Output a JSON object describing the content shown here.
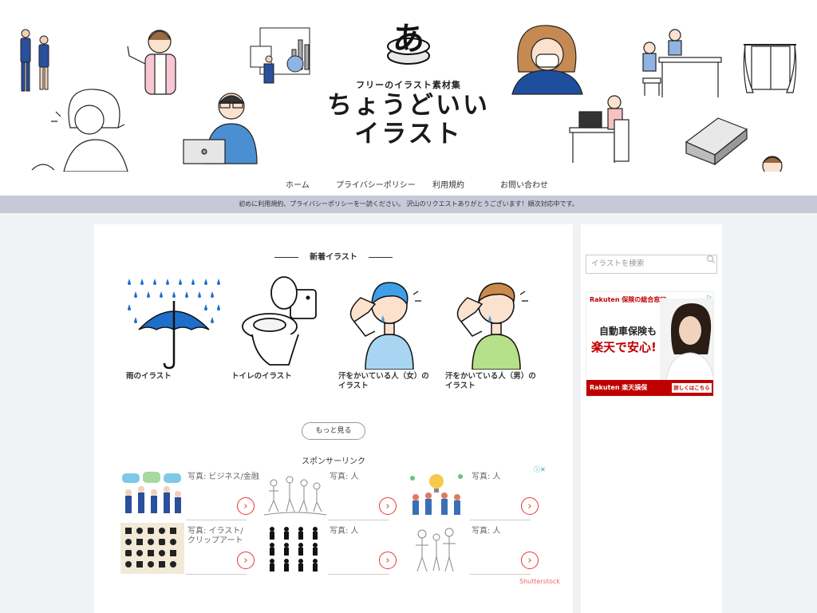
{
  "header": {
    "tagline": "フリーのイラスト素材集",
    "title_line1": "ちょうどいい",
    "title_line2": "イラスト"
  },
  "nav": [
    {
      "label": "ホーム"
    },
    {
      "label": "プライバシーポリシー"
    },
    {
      "label": "利用規約"
    },
    {
      "label": "お問い合わせ"
    }
  ],
  "notice": "初めに利用規約、プライバシーポリシーを一読ください。 沢山のリクエストありがとうございます！順次対応中です。",
  "main": {
    "section_title": "新着イラスト",
    "cards": [
      {
        "caption": "雨のイラスト"
      },
      {
        "caption": "トイレのイラスト"
      },
      {
        "caption": "汗をかいている人（女）の\nイラスト"
      },
      {
        "caption": "汗をかいている人（男）の\nイラスト"
      }
    ],
    "more_label": "もっと見る",
    "sponsor_label": "スポンサーリンク",
    "ads": [
      {
        "text": "写真: ビジネス/金融"
      },
      {
        "text": "写真: 人"
      },
      {
        "text": "写真: 人"
      },
      {
        "text": "写真: イラスト/\nクリップアート"
      },
      {
        "text": "写真: 人"
      },
      {
        "text": "写真: 人"
      }
    ],
    "ad_provider": "Shutterstock",
    "ad_close": "ⓘ✕"
  },
  "sidebar": {
    "search_placeholder": "イラストを検索",
    "banner": {
      "top": "Rakuten 保険の総合窓口",
      "line1": "自動車保険も",
      "line2": "楽天で安心!",
      "footer": "Rakuten 楽天損保",
      "button": "詳しくはこちら"
    }
  },
  "colors": {
    "notice_bg": "#c7c9d8",
    "page_bg": "#f1f2f6",
    "umbrella": "#1e6fc9",
    "rakuten_red": "#bf0000"
  }
}
